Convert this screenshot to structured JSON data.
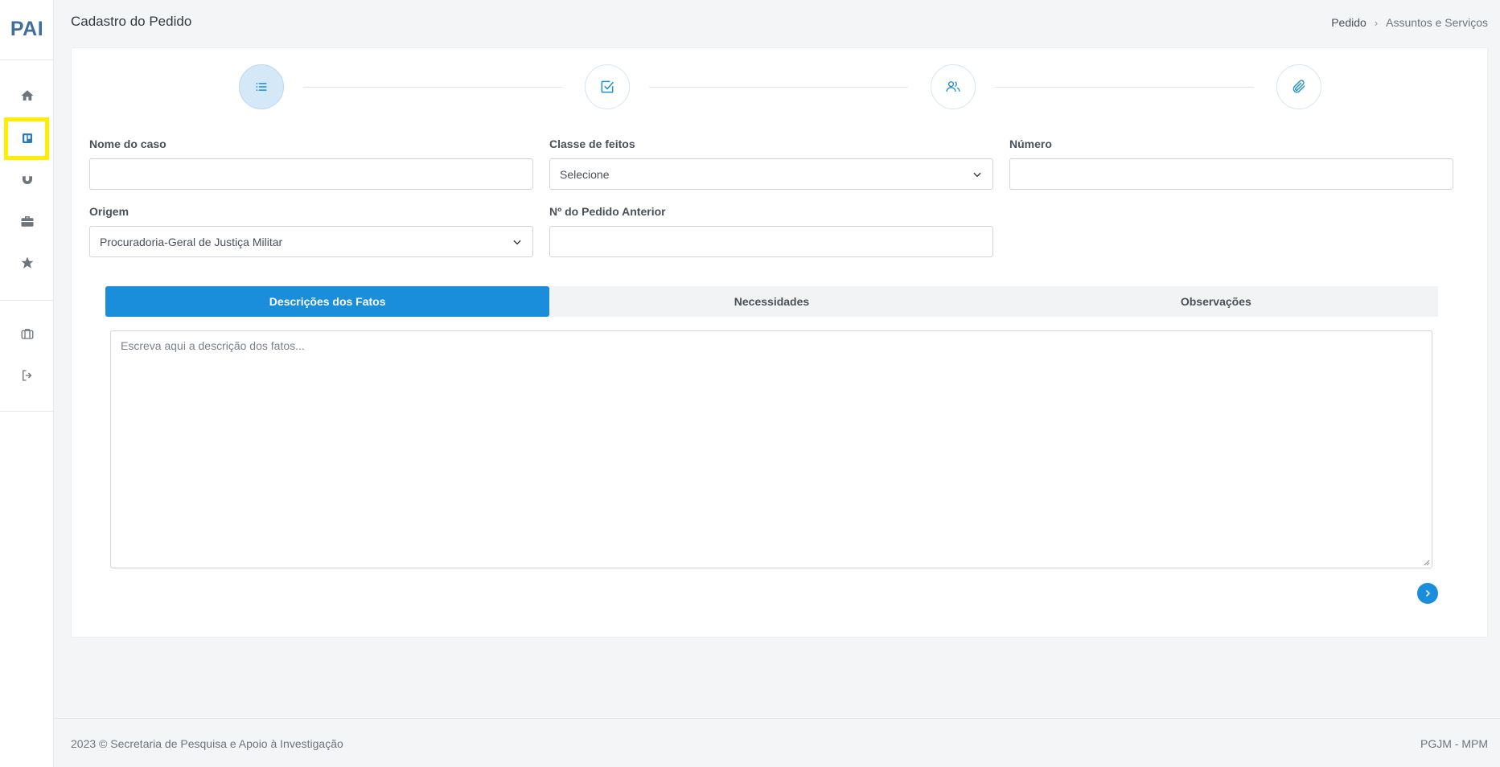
{
  "app": {
    "logo": "PAI"
  },
  "header": {
    "title": "Cadastro do Pedido",
    "breadcrumb": {
      "item1": "Pedido",
      "separator": "›",
      "item2": "Assuntos e Serviços"
    }
  },
  "sidebar": {
    "items": [
      {
        "icon": "home-icon"
      },
      {
        "icon": "board-icon",
        "highlighted": true
      },
      {
        "icon": "magnet-icon"
      },
      {
        "icon": "briefcase-icon"
      },
      {
        "icon": "star-icon"
      },
      {
        "icon": "suitcase-icon"
      },
      {
        "icon": "logout-icon"
      }
    ]
  },
  "stepper": {
    "steps": [
      {
        "icon": "list-icon",
        "active": true
      },
      {
        "icon": "checkbox-icon",
        "active": false
      },
      {
        "icon": "users-icon",
        "active": false
      },
      {
        "icon": "paperclip-icon",
        "active": false
      }
    ]
  },
  "form": {
    "nome_caso": {
      "label": "Nome do caso",
      "value": ""
    },
    "classe_feitos": {
      "label": "Classe de feitos",
      "value": "Selecione"
    },
    "numero": {
      "label": "Número",
      "value": ""
    },
    "origem": {
      "label": "Origem",
      "value": "Procuradoria-Geral de Justiça Militar"
    },
    "pedido_anterior": {
      "label": "Nº do Pedido Anterior",
      "value": ""
    }
  },
  "tabs": [
    {
      "label": "Descrições dos Fatos",
      "active": true
    },
    {
      "label": "Necessidades",
      "active": false
    },
    {
      "label": "Observações",
      "active": false
    }
  ],
  "description": {
    "placeholder": "Escreva aqui a descrição dos fatos..."
  },
  "footer": {
    "left": "2023 © Secretaria de Pesquisa e Apoio à Investigação",
    "right": "PGJM - MPM"
  },
  "colors": {
    "primary": "#1a8edb",
    "logo": "#3f6f9d",
    "highlight": "#ffee00"
  }
}
